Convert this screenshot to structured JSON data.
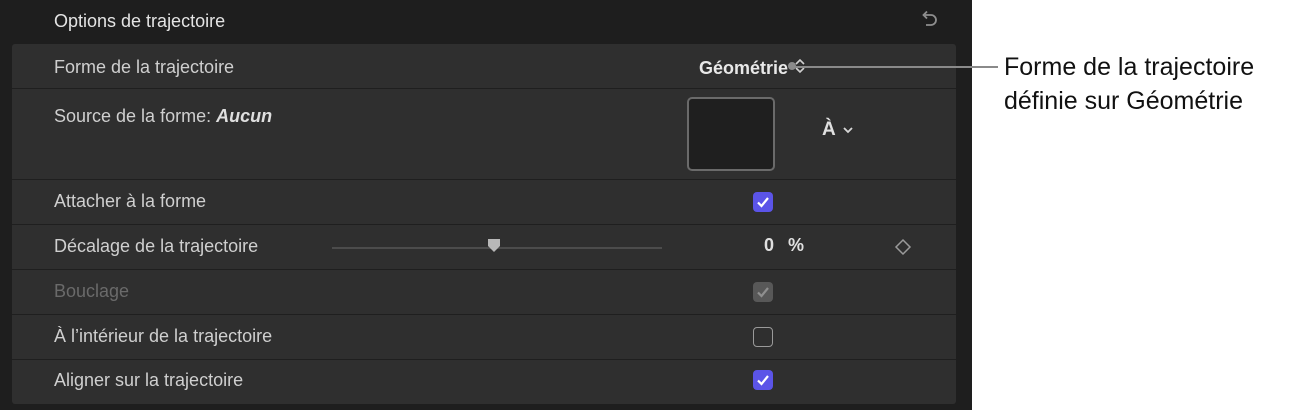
{
  "panel": {
    "title": "Options de trajectoire",
    "icons": {
      "undo": "undo-arrow-icon"
    }
  },
  "rows": {
    "path_shape": {
      "label": "Forme de la trajectoire",
      "value": "Géométrie"
    },
    "shape_source": {
      "label": "Source de la forme: ",
      "value": "Aucun",
      "to_menu": "À"
    },
    "attach_to_shape": {
      "label": "Attacher à la forme",
      "checked": true
    },
    "path_offset": {
      "label": "Décalage de la trajectoire",
      "value": "0",
      "unit": "%",
      "slider_fraction": 0.5
    },
    "loop": {
      "label": "Bouclage",
      "checked": true,
      "disabled": true
    },
    "inside_path": {
      "label": "À l’intérieur de la trajectoire",
      "checked": false
    },
    "align_to_path": {
      "label": "Aligner sur la trajectoire",
      "checked": true
    }
  },
  "callout": {
    "line1": "Forme de la trajectoire",
    "line2": "définie sur Géométrie"
  },
  "colors": {
    "panel_bg": "#1e1e1e",
    "row_bg": "#2f2f2f",
    "checkbox_accent": "#5b54e8"
  }
}
